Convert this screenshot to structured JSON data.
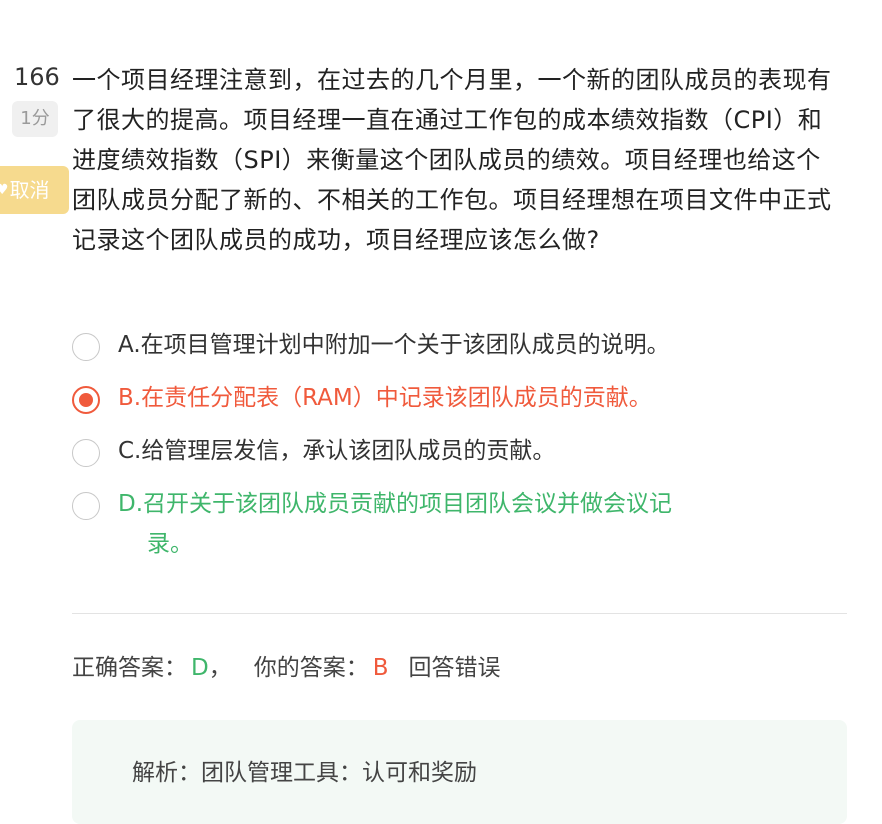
{
  "question": {
    "number": "166",
    "score": "1分",
    "cancel_label": "取消",
    "text": "一个项目经理注意到，在过去的几个月里，一个新的团队成员的表现有了很大的提高。项目经理一直在通过工作包的成本绩效指数（CPI）和进度绩效指数（SPI）来衡量这个团队成员的绩效。项目经理也给这个团队成员分配了新的、不相关的工作包。项目经理想在项目文件中正式记录这个团队成员的成功，项目经理应该怎么做?"
  },
  "options": [
    {
      "text": "A.在项目管理计划中附加一个关于该团队成员的说明。",
      "state": "normal",
      "checked": false
    },
    {
      "text": "B.在责任分配表（RAM）中记录该团队成员的贡献。",
      "state": "wrong",
      "checked": true
    },
    {
      "text": "C.给管理层发信，承认该团队成员的贡献。",
      "state": "normal",
      "checked": false
    },
    {
      "text": "D.召开关于该团队成员贡献的项目团队会议并做会议记",
      "text_cont": "录。",
      "state": "right",
      "checked": false
    }
  ],
  "answer": {
    "correct_label": "正确答案：",
    "correct_value": "D",
    "separator": "，",
    "your_label": "你的答案：",
    "your_value": "B",
    "result": "回答错误"
  },
  "analysis": {
    "label": "解析：",
    "text": "团队管理工具：认可和奖励"
  },
  "colors": {
    "wrong": "#f05a3c",
    "right": "#3fb66b",
    "cancel_bg": "#f6da8e",
    "analysis_bg": "#f3f9f5"
  },
  "icons": {
    "cancel": "heart-icon"
  }
}
